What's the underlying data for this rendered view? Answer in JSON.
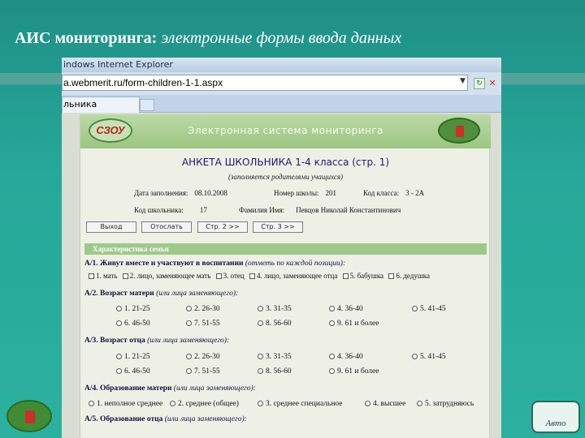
{
  "slide": {
    "title_bold": "АИС мониторинга:",
    "title_italic": "электронные формы ввода данных"
  },
  "browser": {
    "window_title": "indows Internet Explorer",
    "address": "a.webmerit.ru/form-children-1-1.aspx",
    "tab_label": "льника"
  },
  "site": {
    "logo_text": "СЗОУ",
    "header_title": "Электронная система мониторинга"
  },
  "form": {
    "title": "АНКЕТА ШКОЛЬНИКА 1-4 класса (стр. 1)",
    "subtitle": "(заполняется родителями учащихся)",
    "fill_date_label": "Дата заполнения:",
    "fill_date": "08.10.2008",
    "school_label": "Номер школы:",
    "school": "201",
    "class_code_label": "Код класса:",
    "class_code": "3 - 2А",
    "student_code_label": "Код школьника:",
    "student_code": "17",
    "name_label": "Фамилия Имя:",
    "name": "Певцов Николай Константинович"
  },
  "buttons": {
    "exit": "Выход",
    "submit": "Отослать",
    "page2": "Стр. 2 >>",
    "page3": "Стр. 3 >>"
  },
  "section": {
    "title": "Характеристика семьи"
  },
  "questions": {
    "a1": {
      "label": "А/1. Живут вместе и участвуют в воспитании",
      "hint": "(отметь по каждой позиции):"
    },
    "a1_options": [
      "1. мать",
      "2. лицо, заменяющее мать",
      "3. отец",
      "4. лицо, заменяющее отца",
      "5. бабушка",
      "6. дедушка"
    ],
    "a2": {
      "label": "А/2. Возраст матери",
      "hint": "(или лица заменяющего):"
    },
    "a3": {
      "label": "А/3. Возраст отца",
      "hint": "(или лица заменяющего):"
    },
    "age_options": [
      "1. 21-25",
      "2. 26-30",
      "3. 31-35",
      "4. 36-40",
      "5. 41-45",
      "6. 46-50",
      "7. 51-55",
      "8. 56-60",
      "9. 61 и более"
    ],
    "a4": {
      "label": "А/4. Образование матери",
      "hint": "(или лица заменяющего):"
    },
    "edu_options": [
      "1. неполное среднее",
      "2. среднее (общее)",
      "3. среднее специальное",
      "4. высшее",
      "5. затрудняюсь"
    ],
    "a5": {
      "label": "А/5. Образование отца",
      "hint": "(или лица заменяющего):"
    }
  },
  "footer": {
    "right_icon_text": "Авто"
  },
  "colors": {
    "slide_bg": "#27a89a",
    "header_green": "#9cc581",
    "section_green": "#9fc98a"
  }
}
